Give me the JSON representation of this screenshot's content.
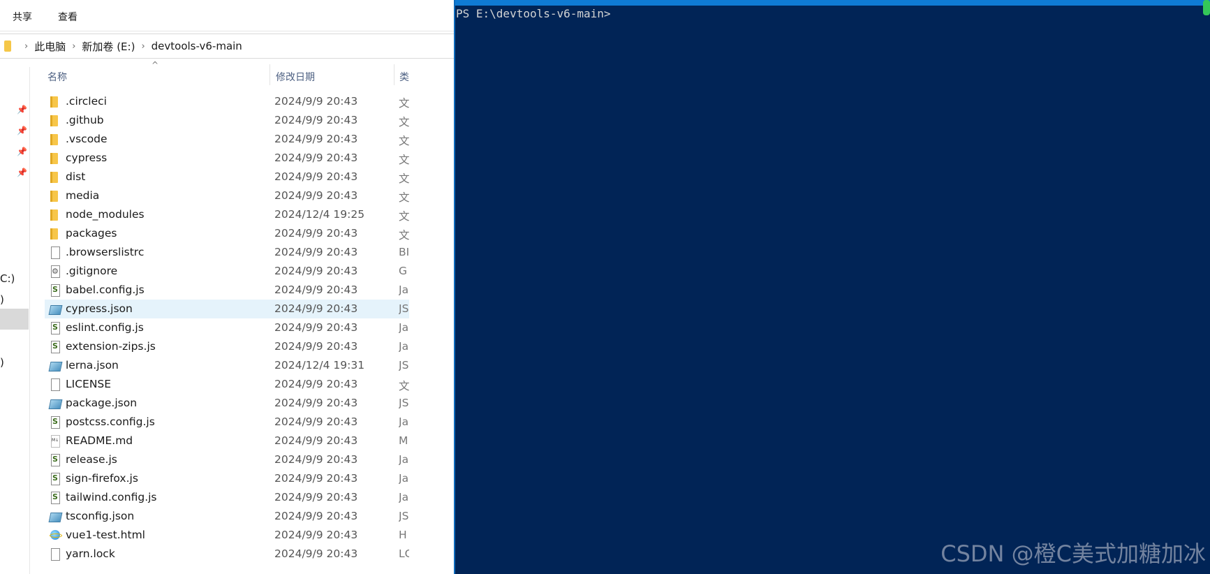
{
  "explorer": {
    "ribbon_tabs": [
      "共享",
      "查看"
    ],
    "breadcrumb": [
      "此电脑",
      "新加卷 (E:)",
      "devtools-v6-main"
    ],
    "columns": {
      "name": "名称",
      "modified": "修改日期",
      "type": "类"
    },
    "nav_fragments": [
      "C:)",
      ")",
      "",
      "",
      ")"
    ],
    "files": [
      {
        "name": ".circleci",
        "date": "2024/9/9 20:43",
        "type": "文",
        "icon": "folder-icon"
      },
      {
        "name": ".github",
        "date": "2024/9/9 20:43",
        "type": "文",
        "icon": "folder-icon"
      },
      {
        "name": ".vscode",
        "date": "2024/9/9 20:43",
        "type": "文",
        "icon": "folder-icon"
      },
      {
        "name": "cypress",
        "date": "2024/9/9 20:43",
        "type": "文",
        "icon": "folder-icon"
      },
      {
        "name": "dist",
        "date": "2024/9/9 20:43",
        "type": "文",
        "icon": "folder-icon"
      },
      {
        "name": "media",
        "date": "2024/9/9 20:43",
        "type": "文",
        "icon": "folder-icon"
      },
      {
        "name": "node_modules",
        "date": "2024/12/4 19:25",
        "type": "文",
        "icon": "folder-icon"
      },
      {
        "name": "packages",
        "date": "2024/9/9 20:43",
        "type": "文",
        "icon": "folder-icon"
      },
      {
        "name": ".browserslistrc",
        "date": "2024/9/9 20:43",
        "type": "BI",
        "icon": "file-icon"
      },
      {
        "name": ".gitignore",
        "date": "2024/9/9 20:43",
        "type": "G",
        "icon": "settings-file-icon"
      },
      {
        "name": "babel.config.js",
        "date": "2024/9/9 20:43",
        "type": "Ja",
        "icon": "js-file-icon"
      },
      {
        "name": "cypress.json",
        "date": "2024/9/9 20:43",
        "type": "JS",
        "icon": "json-file-icon",
        "selected": true
      },
      {
        "name": "eslint.config.js",
        "date": "2024/9/9 20:43",
        "type": "Ja",
        "icon": "js-file-icon"
      },
      {
        "name": "extension-zips.js",
        "date": "2024/9/9 20:43",
        "type": "Ja",
        "icon": "js-file-icon"
      },
      {
        "name": "lerna.json",
        "date": "2024/12/4 19:31",
        "type": "JS",
        "icon": "json-file-icon"
      },
      {
        "name": "LICENSE",
        "date": "2024/9/9 20:43",
        "type": "文",
        "icon": "file-icon"
      },
      {
        "name": "package.json",
        "date": "2024/9/9 20:43",
        "type": "JS",
        "icon": "json-file-icon"
      },
      {
        "name": "postcss.config.js",
        "date": "2024/9/9 20:43",
        "type": "Ja",
        "icon": "js-file-icon"
      },
      {
        "name": "README.md",
        "date": "2024/9/9 20:43",
        "type": "M",
        "icon": "markdown-file-icon"
      },
      {
        "name": "release.js",
        "date": "2024/9/9 20:43",
        "type": "Ja",
        "icon": "js-file-icon"
      },
      {
        "name": "sign-firefox.js",
        "date": "2024/9/9 20:43",
        "type": "Ja",
        "icon": "js-file-icon"
      },
      {
        "name": "tailwind.config.js",
        "date": "2024/9/9 20:43",
        "type": "Ja",
        "icon": "js-file-icon"
      },
      {
        "name": "tsconfig.json",
        "date": "2024/9/9 20:43",
        "type": "JS",
        "icon": "json-file-icon"
      },
      {
        "name": "vue1-test.html",
        "date": "2024/9/9 20:43",
        "type": "H",
        "icon": "html-file-icon"
      },
      {
        "name": "yarn.lock",
        "date": "2024/9/9 20:43",
        "type": "LC",
        "icon": "file-icon"
      }
    ]
  },
  "terminal": {
    "prompt": "PS E:\\devtools-v6-main>"
  },
  "watermark": "CSDN @橙C美式加糖加冰",
  "colors": {
    "terminal_bg": "#012456",
    "selection": "#e5f3fb",
    "accent": "#0f7bd4"
  }
}
